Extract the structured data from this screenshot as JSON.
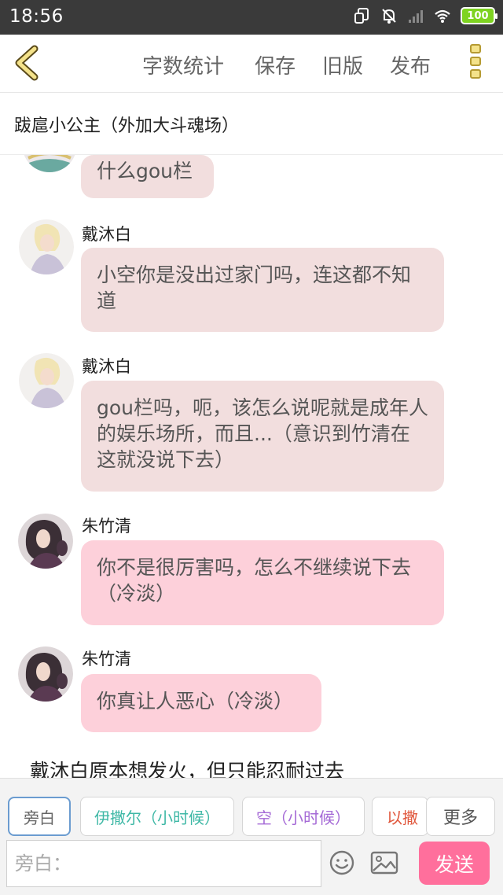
{
  "status_bar": {
    "time": "18:56",
    "battery": "100",
    "icons": [
      "screen-rotation-icon",
      "mute-bell-icon",
      "signal-icon",
      "wifi-icon",
      "battery-icon"
    ]
  },
  "top_bar": {
    "back_icon": "chevron-left-icon",
    "actions": [
      "字数统计",
      "保存",
      "旧版",
      "发布"
    ],
    "menu_icon": "more-vertical-icon",
    "accent_color": "#f4e28a"
  },
  "chapter": {
    "title": "跋扈小公主（外加大斗魂场）"
  },
  "messages": [
    {
      "speaker": "",
      "text": "什么gou栏",
      "style": "dmb"
    },
    {
      "speaker": "戴沐白",
      "text": "小空你是没出过家门吗，连这都不知道",
      "style": "dmb"
    },
    {
      "speaker": "戴沐白",
      "text": "gou栏吗，呃，该怎么说呢就是成年人的娱乐场所，而且...（意识到竹清在这就没说下去）",
      "style": "dmb"
    },
    {
      "speaker": "朱竹清",
      "text": "你不是很厉害吗，怎么不继续说下去（冷淡）",
      "style": "zzq"
    },
    {
      "speaker": "朱竹清",
      "text": "你真让人恶心（冷淡）",
      "style": "zzq"
    }
  ],
  "narration": "戴沐白原本想发火，但只能忍耐过去",
  "bubble_colors": {
    "dmb": "#f2dede",
    "zzq": "#fdd0da"
  },
  "roles": [
    {
      "label": "旁白",
      "color": "#666666",
      "active": true
    },
    {
      "label": "伊撒尔（小时候）",
      "color": "#3fb8a6",
      "active": false
    },
    {
      "label": "空（小时候）",
      "color": "#a56ad6",
      "active": false
    },
    {
      "label": "以撒",
      "color": "#e0563b",
      "active": false
    }
  ],
  "more_label": "更多",
  "input": {
    "placeholder": "旁白：",
    "value": ""
  },
  "send_label": "发送",
  "send_color": "#ff6f9c"
}
